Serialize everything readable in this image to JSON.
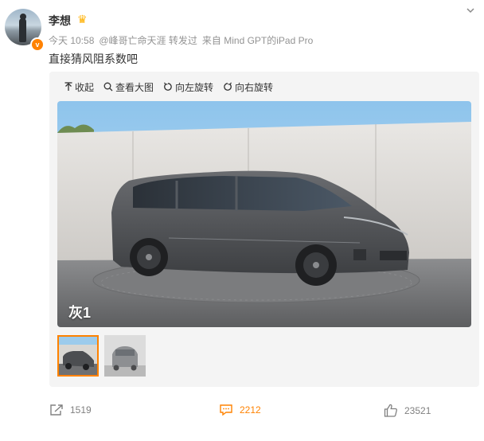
{
  "user": {
    "name": "李想",
    "verified_badge": "v"
  },
  "post": {
    "time": "今天 10:58",
    "repost_from": "@峰哥亡命天涯 转发过",
    "source": "来自 Mind GPT的iPad Pro",
    "text": "直接猜风阻系数吧"
  },
  "media": {
    "toolbar": {
      "collapse": "收起",
      "view_large": "查看大图",
      "rotate_left": "向左旋转",
      "rotate_right": "向右旋转"
    },
    "photo_label": "灰1",
    "thumbnail_count_selected": 1
  },
  "actions": {
    "repost_count": "1519",
    "comment_count": "2212",
    "like_count": "23521"
  },
  "colors": {
    "accent": "#ff8200",
    "text_secondary": "#939393"
  }
}
